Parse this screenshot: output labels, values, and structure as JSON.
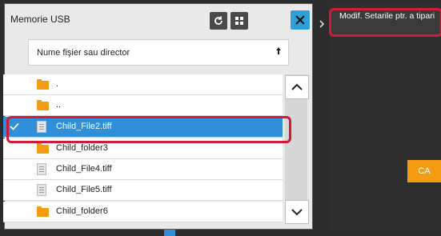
{
  "dialog": {
    "title": "Memorie USB",
    "sort_label": "Nume fişier sau director",
    "icons": {
      "refresh": "refresh-icon",
      "grid": "grid-icon",
      "close": "close-icon",
      "sort": "arrow-up-icon",
      "scroll_up": "chevron-up-icon",
      "scroll_down": "chevron-down-icon"
    }
  },
  "files": [
    {
      "name": ".",
      "type": "folder",
      "selected": false
    },
    {
      "name": "..",
      "type": "folder",
      "selected": false
    },
    {
      "name": "Child_File2.tiff",
      "type": "file",
      "selected": true
    },
    {
      "name": "Child_folder3",
      "type": "folder",
      "selected": false
    },
    {
      "name": "Child_File4.tiff",
      "type": "file",
      "selected": false
    },
    {
      "name": "Child_File5.tiff",
      "type": "file",
      "selected": false
    },
    {
      "name": "Child_folder6",
      "type": "folder",
      "selected": false
    }
  ],
  "right_panel": {
    "print_settings_label": "Modif. Setarile ptr. a tipari",
    "ca_label": "CA"
  },
  "colors": {
    "accent": "#2f8fd8",
    "highlight": "#d11a3a",
    "folder": "#f39c12"
  }
}
